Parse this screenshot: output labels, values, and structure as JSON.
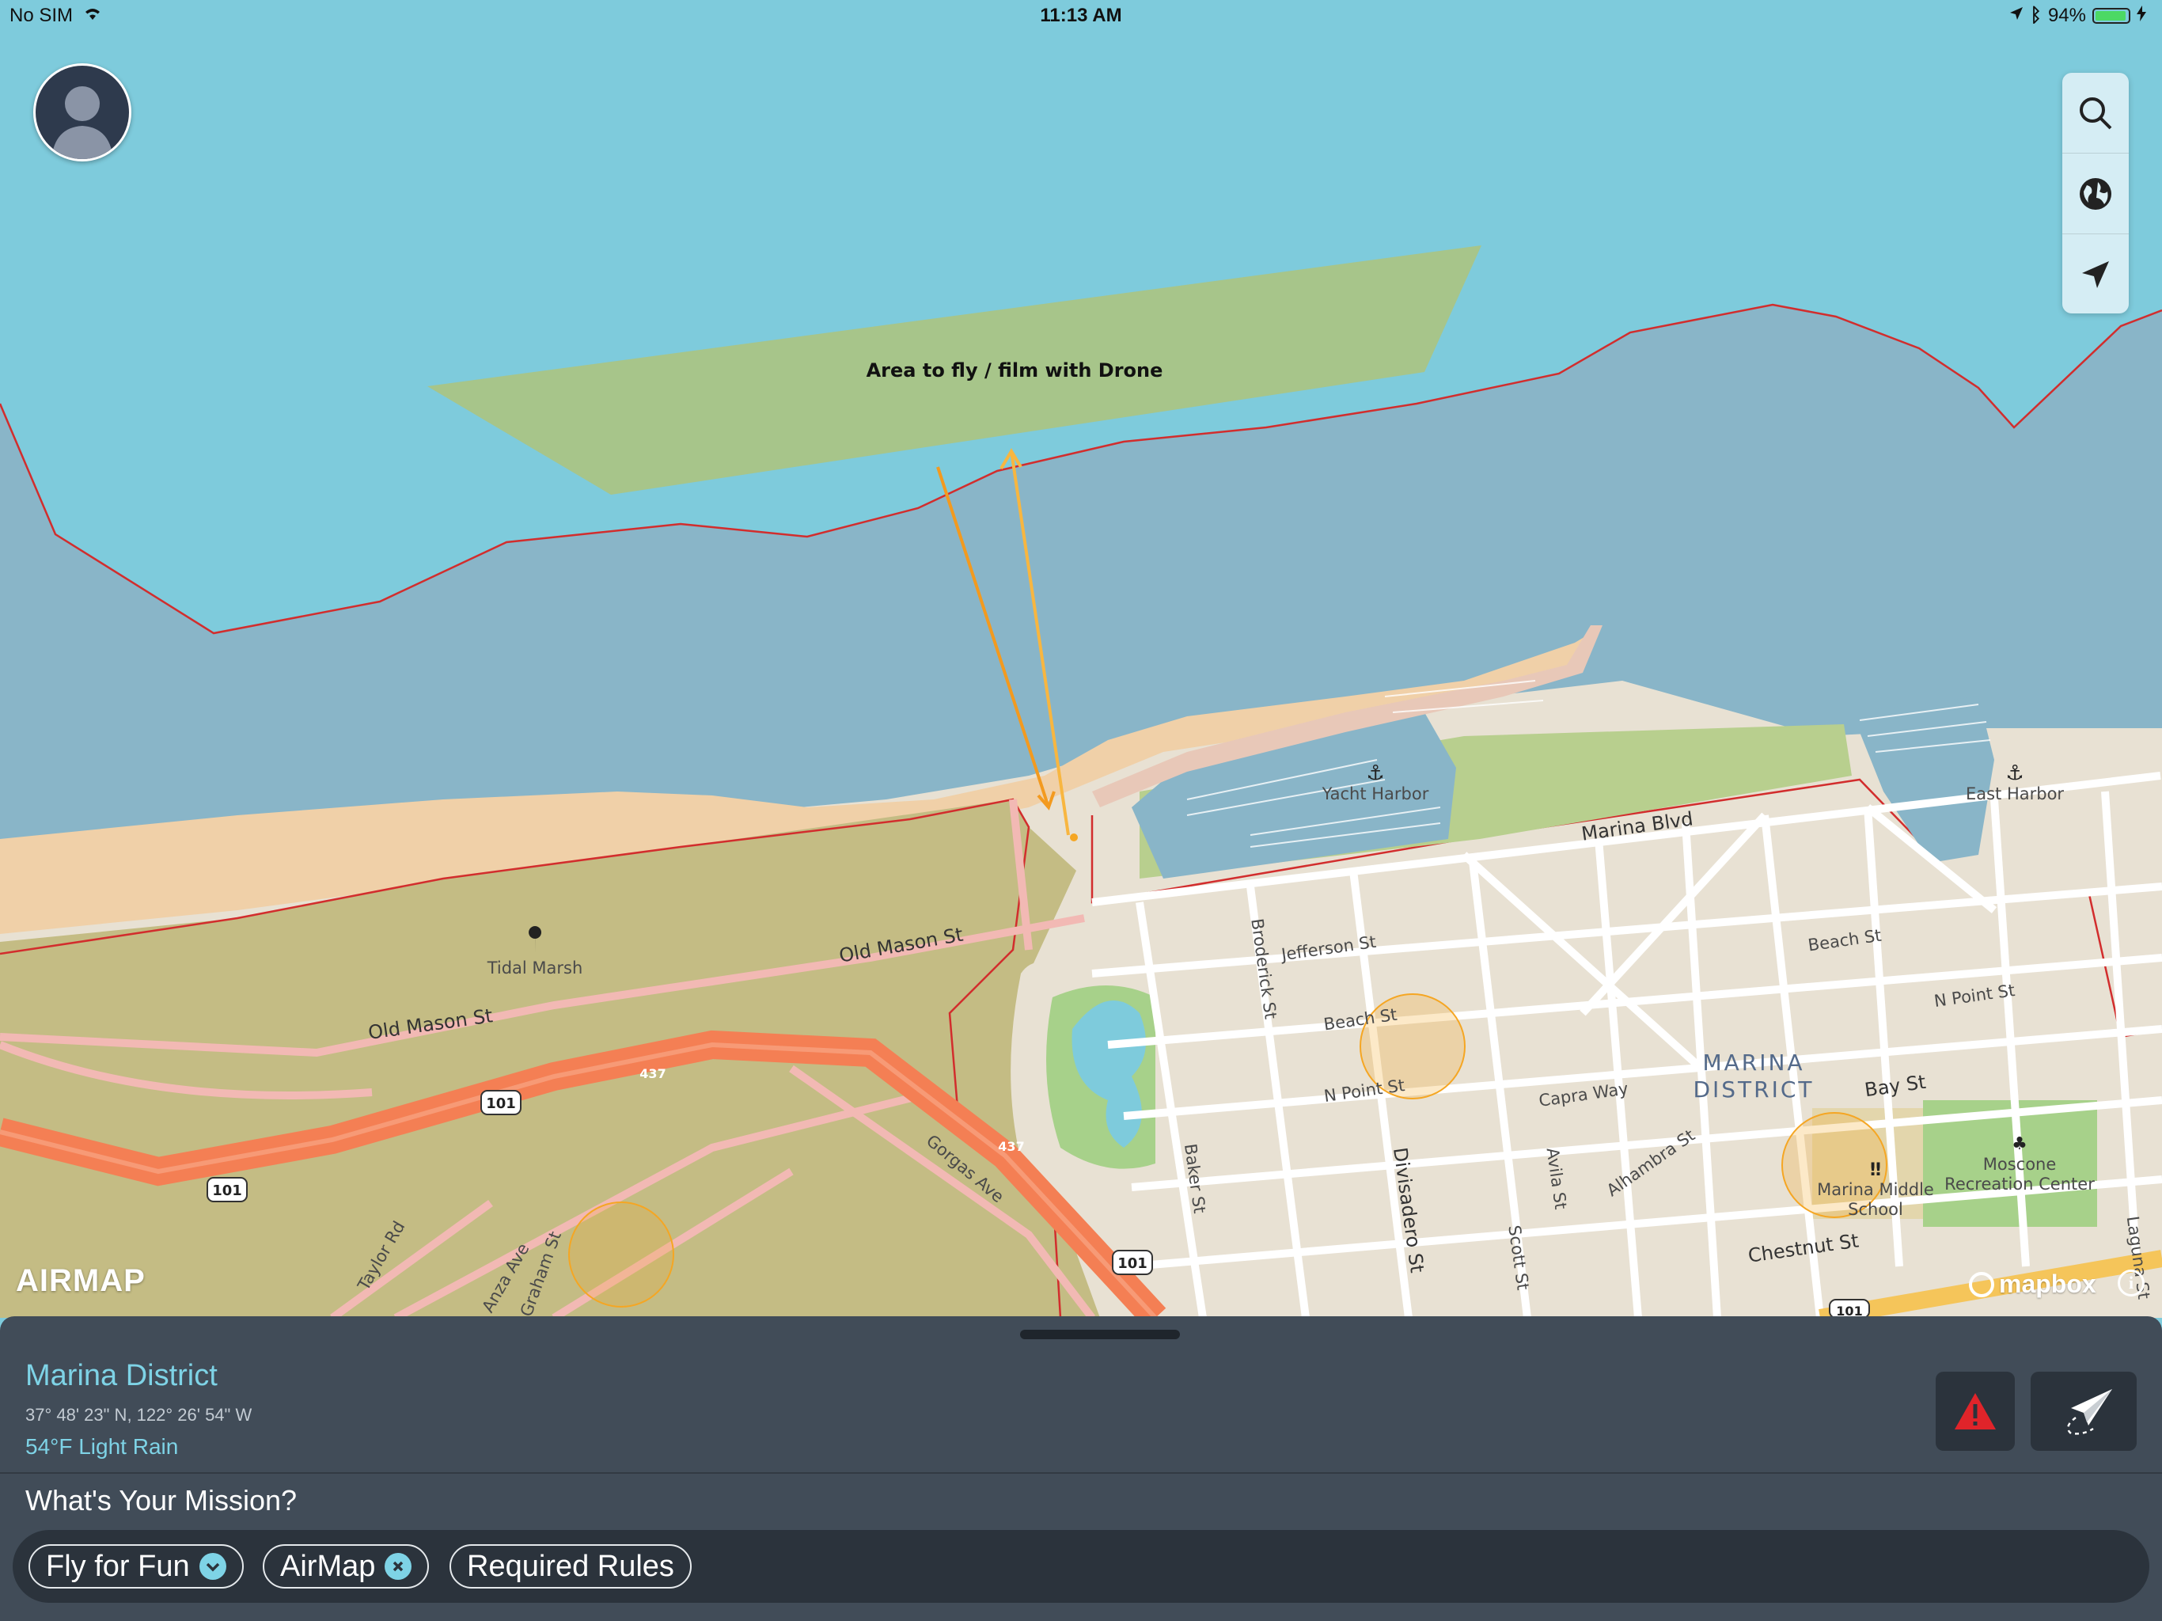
{
  "status_bar": {
    "carrier": "No SIM",
    "time": "11:13 AM",
    "battery_percent": "94%",
    "battery_level": 0.94,
    "icons": [
      "wifi-icon",
      "location-arrow-icon",
      "bluetooth-icon",
      "battery-icon",
      "charging-icon"
    ]
  },
  "map": {
    "drawn_area_label": "Area to fly / film with Drone",
    "place_labels": {
      "tidal_marsh": "Tidal Marsh",
      "yacht_harbor": "Yacht Harbor",
      "east_harbor": "East Harbor",
      "marina_district_1": "MARINA",
      "marina_district_2": "DISTRICT",
      "marina_middle_school_1": "Marina Middle",
      "marina_middle_school_2": "School",
      "moscone_1": "Moscone",
      "moscone_2": "Recreation Center"
    },
    "street_labels": {
      "marina_blvd": "Marina Blvd",
      "old_mason_1": "Old Mason St",
      "old_mason_2": "Old Mason St",
      "jefferson": "Jefferson St",
      "beach_st": "Beach St",
      "beach_st_east": "Beach St",
      "n_point": "N Point St",
      "n_point_east": "N Point St",
      "bay_st": "Bay St",
      "capra_way": "Capra Way",
      "alhambra": "Alhambra St",
      "chestnut": "Chestnut St",
      "broderick": "Broderick St",
      "baker": "Baker St",
      "divisadero": "Divisadero St",
      "avila": "Avila St",
      "scott": "Scott St",
      "gorgas": "Gorgas Ave",
      "taylor_rd": "Taylor Rd",
      "anza_ave": "Anza Ave",
      "graham_st": "Graham St",
      "laguna": "Laguna St"
    },
    "shields": {
      "us101_a": "101",
      "us101_b": "101",
      "us101_c": "101",
      "us101_d": "101",
      "hwy437_a": "437",
      "hwy437_b": "437"
    },
    "colors": {
      "water_light": "#7ecbdc",
      "water_restricted": "#89b5c8",
      "land": "#e8e1d3",
      "restricted_land": "#c4bc84",
      "park": "#a7d18a",
      "fly_area": "#a8c487",
      "boundary": "#d22d2d",
      "highway": "#f47f54",
      "advisory_circle": "#f5a623"
    },
    "attribution_airmap": "AIRMAP",
    "attribution_mapbox": "mapbox",
    "info_symbol": "i"
  },
  "toolbar": {
    "search_icon": "search-icon",
    "globe_icon": "globe-icon",
    "locate_icon": "location-arrow-icon"
  },
  "panel": {
    "place_name": "Marina District",
    "coordinates": "37° 48' 23\" N, 122° 26' 54\" W",
    "weather": "54°F Light Rain",
    "mission_question": "What's Your Mission?",
    "chips": [
      {
        "label": "Fly for Fun",
        "icon": "chevron-down-icon"
      },
      {
        "label": "AirMap",
        "icon": "close-icon"
      },
      {
        "label": "Required Rules",
        "icon": ""
      }
    ],
    "warning_icon": "warning-icon",
    "send_icon": "paper-plane-icon",
    "accent": "#7ed3e6"
  }
}
